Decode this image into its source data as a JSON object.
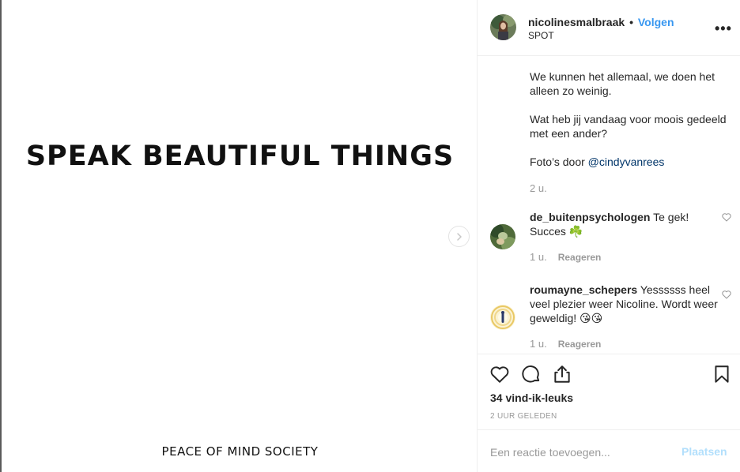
{
  "media": {
    "headline": "SPEAK BEAUTIFUL THINGS",
    "footer": "PEACE OF MIND SOCIETY",
    "next_icon": "chevron-right-icon"
  },
  "header": {
    "username": "nicolinesmalbraak",
    "separator": "•",
    "follow_label": "Volgen",
    "location": "SPOT",
    "more_label": "•••"
  },
  "caption": {
    "line1": "We kunnen het allemaal, we doen het alleen zo weinig.",
    "line2": "Wat heb jij vandaag voor moois gedeeld met een ander?",
    "photo_prefix": "Foto’s door ",
    "photo_mention": "@cindyvanrees",
    "age": "2 u."
  },
  "comments": [
    {
      "username": "de_buitenpsychologen",
      "text": "Te gek! Succes ☘️",
      "age": "1 u.",
      "reply_label": "Reageren"
    },
    {
      "username": "roumayne_schepers",
      "text": "Yessssss heel veel plezier weer Nicoline. Wordt weer geweldig! 😘😘",
      "age": "1 u.",
      "reply_label": "Reageren"
    }
  ],
  "actions": {
    "likes": "34 vind-ik-leuks",
    "timestamp": "2 UUR GELEDEN"
  },
  "add_comment": {
    "placeholder": "Een reactie toevoegen...",
    "post_label": "Plaatsen"
  },
  "colors": {
    "link_blue": "#3897f0",
    "mention": "#003569",
    "muted": "#999999",
    "post_disabled": "#b2dffc"
  }
}
